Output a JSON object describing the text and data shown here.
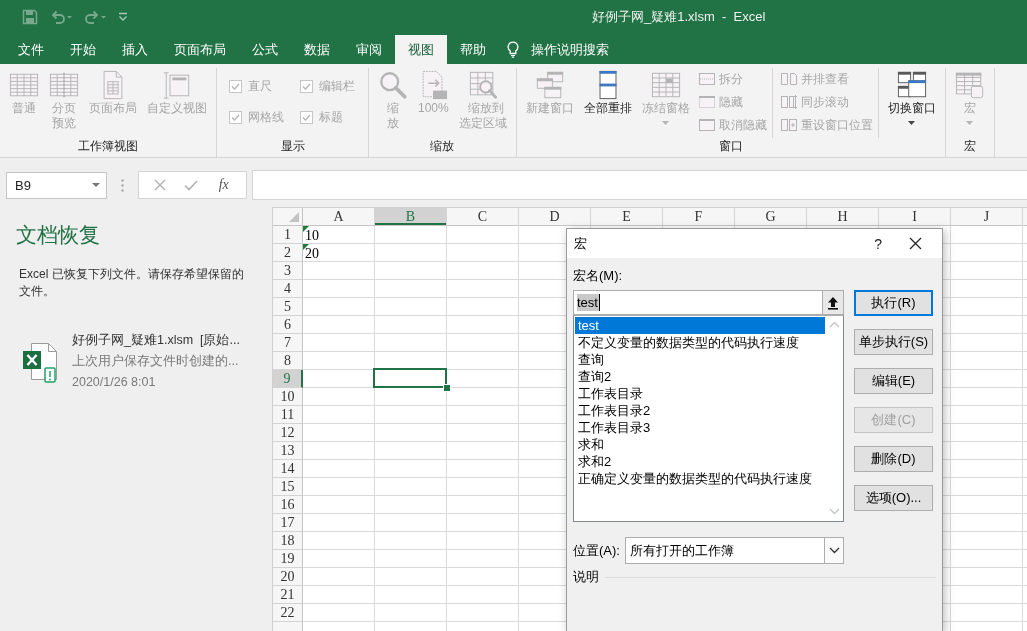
{
  "title_bar": {
    "title": "好例子网_疑难1.xlsm  -  Excel"
  },
  "tabs": [
    {
      "label": "文件",
      "selected": false
    },
    {
      "label": "开始",
      "selected": false
    },
    {
      "label": "插入",
      "selected": false
    },
    {
      "label": "页面布局",
      "selected": false
    },
    {
      "label": "公式",
      "selected": false
    },
    {
      "label": "数据",
      "selected": false
    },
    {
      "label": "审阅",
      "selected": false
    },
    {
      "label": "视图",
      "selected": true
    },
    {
      "label": "帮助",
      "selected": false
    }
  ],
  "tell_me": "操作说明搜索",
  "ribbon": {
    "groups": [
      {
        "label": "工作簿视图",
        "items": [
          {
            "kind": "large",
            "label": "普通",
            "disabled": true,
            "dropdown": false
          },
          {
            "kind": "large",
            "label": "分页预览",
            "disabled": true,
            "dropdown": false
          },
          {
            "kind": "large",
            "label": "页面布局",
            "disabled": true,
            "dropdown": false
          },
          {
            "kind": "large",
            "label": "自定义视图",
            "disabled": true,
            "dropdown": false
          }
        ]
      },
      {
        "label": "显示",
        "items": [
          {
            "kind": "checks",
            "items": [
              {
                "label": "直尺",
                "checked": true,
                "disabled": true
              },
              {
                "label": "编辑栏",
                "checked": true,
                "disabled": true
              },
              {
                "label": "网格线",
                "checked": true,
                "disabled": true
              },
              {
                "label": "标题",
                "checked": true,
                "disabled": true
              }
            ]
          }
        ]
      },
      {
        "label": "缩放",
        "items": [
          {
            "kind": "large",
            "label": "缩放",
            "disabled": true,
            "dropdown": false
          },
          {
            "kind": "large",
            "label": "100%",
            "disabled": true,
            "dropdown": false
          },
          {
            "kind": "large",
            "label": "缩放到选定区域",
            "disabled": true,
            "dropdown": false
          }
        ]
      },
      {
        "label": "窗口",
        "items": [
          {
            "kind": "large",
            "label": "新建窗口",
            "disabled": true,
            "dropdown": false
          },
          {
            "kind": "large",
            "label": "全部重排",
            "disabled": false,
            "dropdown": false
          },
          {
            "kind": "large",
            "label": "冻结窗格",
            "disabled": true,
            "dropdown": true
          },
          {
            "kind": "stack",
            "items": [
              {
                "label": "拆分",
                "disabled": true
              },
              {
                "label": "隐藏",
                "disabled": true
              },
              {
                "label": "取消隐藏",
                "disabled": true
              }
            ]
          },
          {
            "kind": "stack",
            "items": [
              {
                "label": "并排查看",
                "disabled": true
              },
              {
                "label": "同步滚动",
                "disabled": true
              },
              {
                "label": "重设窗口位置",
                "disabled": true
              }
            ]
          },
          {
            "kind": "large",
            "label": "切换窗口",
            "disabled": false,
            "dropdown": true
          }
        ]
      },
      {
        "label": "宏",
        "items": [
          {
            "kind": "large",
            "label": "宏",
            "disabled": true,
            "dropdown": true
          }
        ]
      }
    ]
  },
  "formula_bar": {
    "name_box": "B9",
    "insert_function": "fx"
  },
  "document_recovery": {
    "title": "文档恢复",
    "message": "Excel 已恢复下列文件。请保存希望保留的文件。",
    "files": [
      {
        "name": "好例子网_疑难1.xlsm  [原始...",
        "description": "上次用户保存文件时创建的...",
        "time": "2020/1/26 8:01"
      }
    ]
  },
  "sheet": {
    "columns": [
      {
        "label": "A",
        "selected": false
      },
      {
        "label": "B",
        "selected": true
      },
      {
        "label": "C",
        "selected": false
      },
      {
        "label": "D",
        "selected": false
      },
      {
        "label": "E",
        "selected": false
      },
      {
        "label": "F",
        "selected": false
      },
      {
        "label": "G",
        "selected": false
      },
      {
        "label": "H",
        "selected": false
      },
      {
        "label": "I",
        "selected": false
      },
      {
        "label": "J",
        "selected": false
      }
    ],
    "rows": [
      {
        "label": "1",
        "selected": false,
        "cells": [
          {
            "value": "10",
            "flagged": true
          }
        ]
      },
      {
        "label": "2",
        "selected": false,
        "cells": [
          {
            "value": "20",
            "flagged": true
          }
        ]
      },
      {
        "label": "3",
        "selected": false
      },
      {
        "label": "4",
        "selected": false
      },
      {
        "label": "5",
        "selected": false
      },
      {
        "label": "6",
        "selected": false
      },
      {
        "label": "7",
        "selected": false
      },
      {
        "label": "8",
        "selected": false
      },
      {
        "label": "9",
        "selected": true
      },
      {
        "label": "10",
        "selected": false
      },
      {
        "label": "11",
        "selected": false
      },
      {
        "label": "12",
        "selected": false
      },
      {
        "label": "13",
        "selected": false
      },
      {
        "label": "14",
        "selected": false
      },
      {
        "label": "15",
        "selected": false
      },
      {
        "label": "16",
        "selected": false
      },
      {
        "label": "17",
        "selected": false
      },
      {
        "label": "18",
        "selected": false
      },
      {
        "label": "19",
        "selected": false
      },
      {
        "label": "20",
        "selected": false
      },
      {
        "label": "21",
        "selected": false
      },
      {
        "label": "22",
        "selected": false
      }
    ]
  },
  "macro_dialog": {
    "title": "宏",
    "help": "?",
    "macro_name_label": "宏名(M):",
    "macro_name": {
      "value": "test",
      "text_selected": true
    },
    "macros": [
      {
        "label": "test",
        "selected": true
      },
      {
        "label": "不定义变量的数据类型的代码执行速度",
        "selected": false
      },
      {
        "label": "查询",
        "selected": false
      },
      {
        "label": "查询2",
        "selected": false
      },
      {
        "label": "工作表目录",
        "selected": false
      },
      {
        "label": "工作表目录2",
        "selected": false
      },
      {
        "label": "工作表目录3",
        "selected": false
      },
      {
        "label": "求和",
        "selected": false
      },
      {
        "label": "求和2",
        "selected": false
      },
      {
        "label": "正确定义变量的数据类型的代码执行速度",
        "selected": false
      }
    ],
    "buttons": [
      {
        "label": "执行(R)",
        "default": true,
        "disabled": false
      },
      {
        "label": "单步执行(S)",
        "default": false,
        "disabled": false
      },
      {
        "label": "编辑(E)",
        "default": false,
        "disabled": false
      },
      {
        "label": "创建(C)",
        "default": false,
        "disabled": true
      },
      {
        "label": "删除(D)",
        "default": false,
        "disabled": false
      },
      {
        "label": "选项(O)...",
        "default": false,
        "disabled": false
      }
    ],
    "location_label": "位置(A):",
    "location": "所有打开的工作簿",
    "description_label": "说明"
  }
}
